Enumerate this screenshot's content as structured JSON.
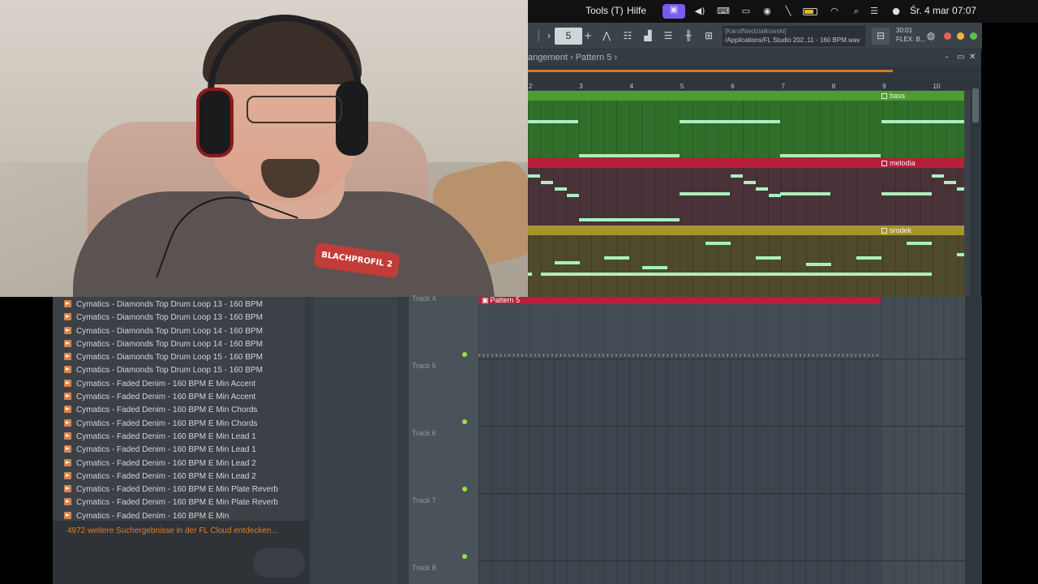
{
  "menubar": {
    "items": [
      "Tools (T)",
      "Hilfe"
    ],
    "clock": "Śr. 4 mar  07:07"
  },
  "toolbar": {
    "pattern_number": "5",
    "hint_user": "[KarolNiedzialkowski]",
    "hint_path": "/Applications/FL Studio 202..11 - 160 BPM.wav",
    "cpu_line1": "30:01",
    "cpu_line2": "FLEX: B..."
  },
  "playlist": {
    "breadcrumb": "angement  ›  Pattern 5  ›",
    "ruler": [
      "2",
      "3",
      "4",
      "5",
      "6",
      "7",
      "8",
      "9",
      "10"
    ],
    "clips": [
      {
        "name": "bass",
        "color": "#4f9e2c",
        "body_color": "#2f6f2a"
      },
      {
        "name": "melodia",
        "color": "#b81d3a",
        "body_color": "#4a3338"
      },
      {
        "name": "srodek",
        "color": "#a8952a",
        "body_color": "#4f4a2c"
      }
    ],
    "tracks": [
      "Track 4",
      "Track 5",
      "Track 6",
      "Track 7",
      "Track 8"
    ],
    "pattern_clip": "Pattern 5",
    "note_accent": "#a9f0be"
  },
  "browser": {
    "items": [
      "Cymatics - Diamonds Top Drum Loop 13 - 160 BPM",
      "Cymatics - Diamonds Top Drum Loop 13 - 160 BPM",
      "Cymatics - Diamonds Top Drum Loop 14 - 160 BPM",
      "Cymatics - Diamonds Top Drum Loop 14 - 160 BPM",
      "Cymatics - Diamonds Top Drum Loop 15 - 160 BPM",
      "Cymatics - Diamonds Top Drum Loop 15 - 160 BPM",
      "Cymatics - Faded Denim - 160 BPM E Min Accent",
      "Cymatics - Faded Denim - 160 BPM E Min Accent",
      "Cymatics - Faded Denim - 160 BPM E Min Chords",
      "Cymatics - Faded Denim - 160 BPM E Min Chords",
      "Cymatics - Faded Denim - 160 BPM E Min Lead 1",
      "Cymatics - Faded Denim - 160 BPM E Min Lead 1",
      "Cymatics - Faded Denim - 160 BPM E Min Lead 2",
      "Cymatics - Faded Denim - 160 BPM E Min Lead 2",
      "Cymatics - Faded Denim - 160 BPM E Min Plate Reverb",
      "Cymatics - Faded Denim - 160 BPM E Min Plate Reverb",
      "Cymatics - Faded Denim - 160 BPM E Min"
    ],
    "cloud_link": "4972 weitere Suchergebnisse in der FL Cloud entdecken..."
  },
  "webcam": {
    "shirt_logo": "BLACHPROFIL 2"
  }
}
